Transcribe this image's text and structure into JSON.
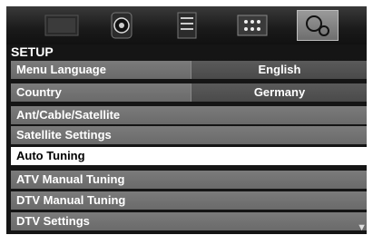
{
  "tabs": [
    {
      "icon": "picture-icon",
      "active": false
    },
    {
      "icon": "sound-icon",
      "active": false
    },
    {
      "icon": "media-icon",
      "active": false
    },
    {
      "icon": "grid-icon",
      "active": false
    },
    {
      "icon": "setup-icon",
      "active": true
    }
  ],
  "section": {
    "title": "SETUP"
  },
  "menu": {
    "menu_language": {
      "label": "Menu Language",
      "value": "English"
    },
    "country": {
      "label": "Country",
      "value": "Germany"
    },
    "ant_cable_satellite": {
      "label": "Ant/Cable/Satellite"
    },
    "satellite_settings": {
      "label": "Satellite Settings"
    },
    "auto_tuning": {
      "label": "Auto Tuning",
      "selected": true
    },
    "atv_manual_tuning": {
      "label": "ATV Manual Tuning"
    },
    "dtv_manual_tuning": {
      "label": "DTV Manual Tuning"
    },
    "dtv_settings": {
      "label": "DTV Settings"
    }
  },
  "scroll_indicator": "▼"
}
